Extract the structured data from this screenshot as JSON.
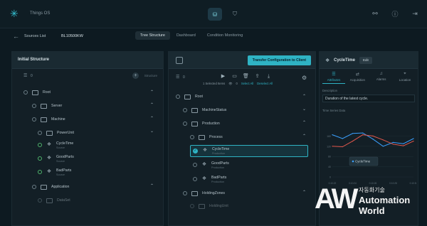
{
  "app": {
    "title": "Things OS"
  },
  "topbar": {
    "center_icons": [
      "database-icon",
      "shield-check-icon"
    ],
    "right_icons": [
      "share-nodes-icon",
      "help-icon",
      "logout-icon"
    ]
  },
  "subbar": {
    "back_label": "Sources List",
    "source_id": "BL10500KW",
    "tabs": [
      {
        "label": "Tree Structure",
        "active": true
      },
      {
        "label": "Dashboard",
        "active": false
      },
      {
        "label": "Condition Monitoring",
        "active": false
      }
    ]
  },
  "left_panel": {
    "title": "Initial Structure",
    "filter_count": "0",
    "add_label": "Structure",
    "nodes": [
      {
        "label": "Root",
        "sub": ""
      },
      {
        "label": "Server",
        "sub": ""
      },
      {
        "label": "Machine",
        "sub": ""
      },
      {
        "label": "PowerUnit",
        "sub": ""
      },
      {
        "label": "CycleTime",
        "sub": "Source"
      },
      {
        "label": "GoodParts",
        "sub": "Source"
      },
      {
        "label": "BadParts",
        "sub": "Source"
      },
      {
        "label": "Application",
        "sub": ""
      },
      {
        "label": "DataSet",
        "sub": ""
      }
    ]
  },
  "mid_panel": {
    "transfer_label": "Transfer Configuration to Client",
    "filter_count": "0",
    "selection_text": "1 Selected Items",
    "selection_count": "0",
    "select_all": "Select All",
    "deselect_all": "Deselect All",
    "nodes": [
      {
        "label": "Root",
        "sub": ""
      },
      {
        "label": "MachineStatus",
        "sub": ""
      },
      {
        "label": "Production",
        "sub": ""
      },
      {
        "label": "Process",
        "sub": ""
      },
      {
        "label": "CycleTime",
        "sub": "Production"
      },
      {
        "label": "GoodParts",
        "sub": "Production"
      },
      {
        "label": "BadParts",
        "sub": "Production"
      },
      {
        "label": "HoldingZones",
        "sub": ""
      },
      {
        "label": "HoldingUnit",
        "sub": ""
      }
    ]
  },
  "right_panel": {
    "title": "CycleTime",
    "edit_label": "Edit",
    "tabs": [
      "Attributes",
      "Acquisition",
      "Alarms",
      "Location"
    ],
    "description_label": "Description",
    "description_value": "Duration of the latest cycle.",
    "timeseries_label": "Time Series Data",
    "tooltip_label": "CycleTime"
  },
  "chart_data": {
    "type": "line",
    "series": [
      {
        "name": "CycleTime",
        "color": "#3aa0ff",
        "values": [
          165,
          150,
          170,
          172,
          148,
          120,
          135,
          130,
          150
        ]
      },
      {
        "name": "",
        "color": "#e2574c",
        "values": [
          120,
          118,
          140,
          165,
          160,
          145,
          128,
          122,
          140
        ]
      }
    ],
    "x": [
      "0:10:22",
      "0:10:23",
      "0:10:24",
      "0:10:25",
      "0:10:26",
      "0:10:27",
      "0:10:28",
      "0:10:29",
      "0:10:30"
    ],
    "ylim": [
      0,
      200
    ],
    "yticks": [
      0,
      40,
      80,
      120,
      160
    ]
  },
  "watermark": {
    "big": "AW",
    "kr": "자동화기술",
    "line1": "Automation",
    "line2": "World"
  }
}
